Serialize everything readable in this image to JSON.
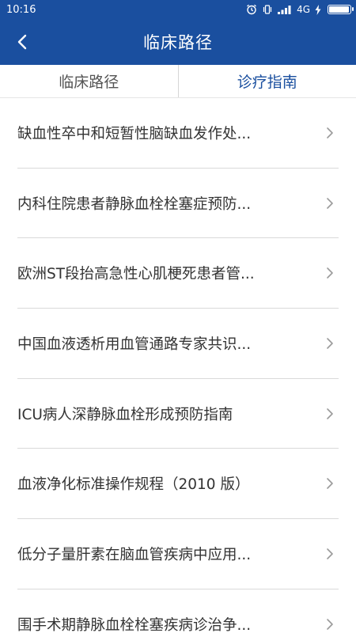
{
  "status_bar": {
    "time": "10:16",
    "network": "4G",
    "icons": [
      "alarm-icon",
      "vibrate-icon",
      "signal-icon",
      "network-type",
      "charging-icon",
      "battery-icon"
    ],
    "battery_level": 0.95
  },
  "header": {
    "title": "临床路径",
    "back_icon": "chevron-left-icon"
  },
  "tabs": [
    {
      "label": "临床路径",
      "active": false
    },
    {
      "label": "诊疗指南",
      "active": true
    }
  ],
  "colors": {
    "brand": "#1a4f9f",
    "active_tab": "#1a4f9f",
    "text": "#333333",
    "divider": "#d9d9d9"
  },
  "list": {
    "items": [
      {
        "label": "缺血性卒中和短暂性脑缺血发作处..."
      },
      {
        "label": "内科住院患者静脉血栓栓塞症预防..."
      },
      {
        "label": "欧洲ST段抬高急性心肌梗死患者管..."
      },
      {
        "label": "中国血液透析用血管通路专家共识..."
      },
      {
        "label": "ICU病人深静脉血栓形成预防指南"
      },
      {
        "label": "血液净化标准操作规程（2010 版）"
      },
      {
        "label": "低分子量肝素在脑血管疾病中应用..."
      },
      {
        "label": "围手术期静脉血栓栓塞疾病诊治争..."
      }
    ],
    "item_icon": "chevron-right-icon"
  }
}
